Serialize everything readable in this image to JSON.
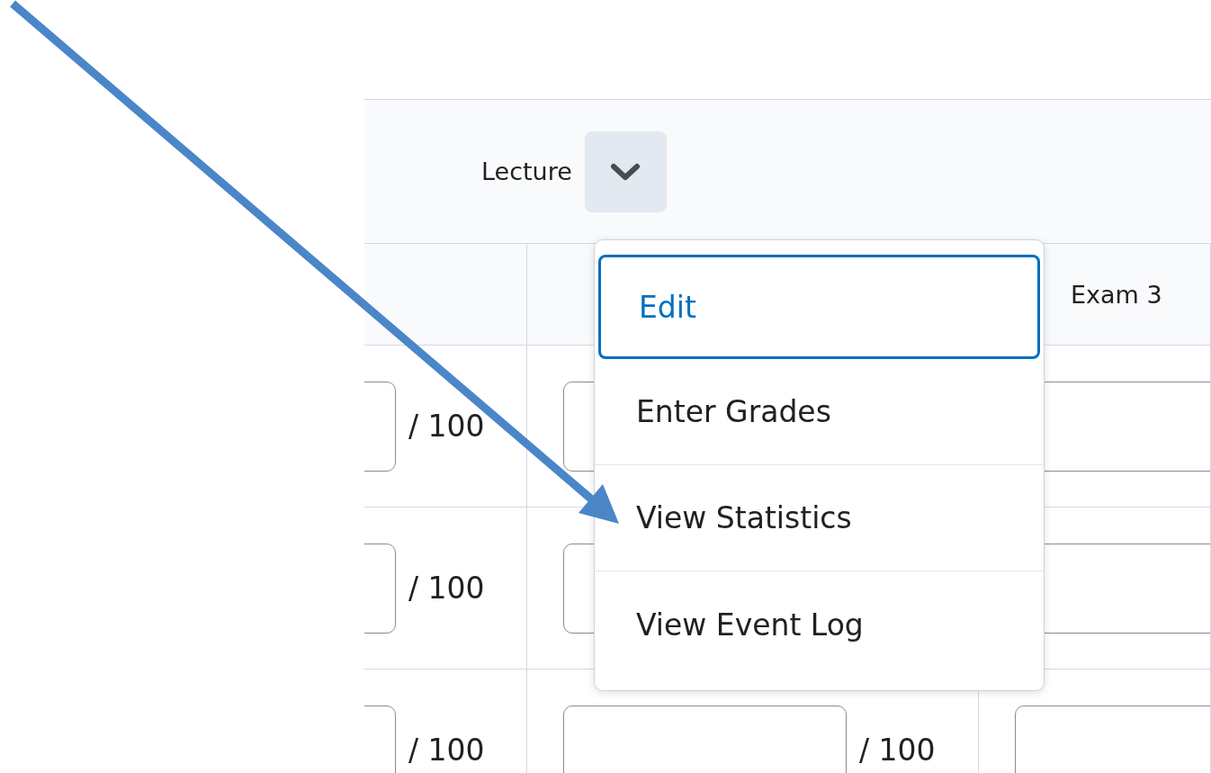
{
  "header": {
    "label": "Lecture",
    "menu_expanded": true
  },
  "exam_column": {
    "title": "Exam 3"
  },
  "rows": [
    {
      "cells": [
        {
          "out_of": "/ 100"
        },
        {},
        {}
      ]
    },
    {
      "cells": [
        {
          "out_of": "/ 100"
        },
        {},
        {}
      ]
    },
    {
      "cells": [
        {
          "out_of": "/ 100"
        },
        {
          "out_of": "/ 100"
        },
        {}
      ]
    }
  ],
  "menu": {
    "items": [
      {
        "label": "Edit",
        "selected": true
      },
      {
        "label": "Enter Grades",
        "selected": false
      },
      {
        "label": "View Statistics",
        "selected": false
      },
      {
        "label": "View Event Log",
        "selected": false
      }
    ]
  }
}
